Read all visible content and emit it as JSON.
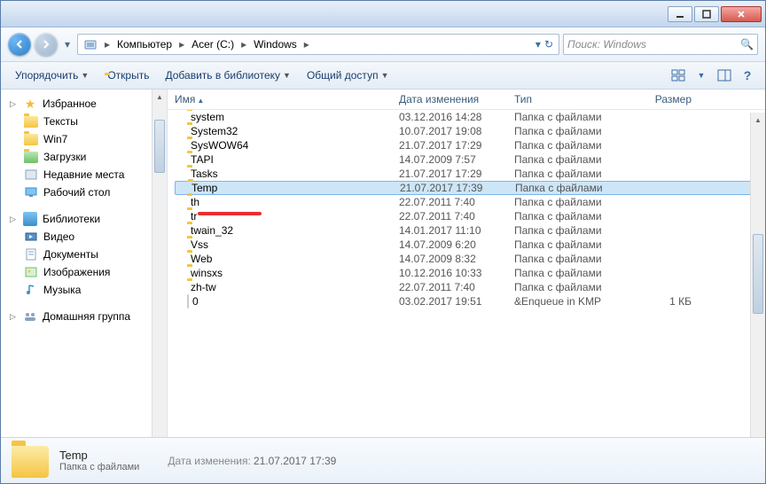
{
  "window": {
    "title": ""
  },
  "breadcrumb": {
    "items": [
      "Компьютер",
      "Acer (C:)",
      "Windows"
    ]
  },
  "search": {
    "placeholder": "Поиск: Windows"
  },
  "toolbar": {
    "organize": "Упорядочить",
    "open": "Открыть",
    "add_lib": "Добавить в библиотеку",
    "share": "Общий доступ"
  },
  "sidebar": {
    "favorites": {
      "label": "Избранное",
      "items": [
        "Тексты",
        "Win7",
        "Загрузки",
        "Недавние места",
        "Рабочий стол"
      ]
    },
    "libraries": {
      "label": "Библиотеки",
      "items": [
        "Видео",
        "Документы",
        "Изображения",
        "Музыка"
      ]
    },
    "homegroup": {
      "label": "Домашняя группа"
    }
  },
  "columns": {
    "name": "Имя",
    "date": "Дата изменения",
    "type": "Тип",
    "size": "Размер"
  },
  "files": [
    {
      "name": "system",
      "date": "03.12.2016 14:28",
      "type": "Папка с файлами",
      "size": "",
      "kind": "folder"
    },
    {
      "name": "System32",
      "date": "10.07.2017 19:08",
      "type": "Папка с файлами",
      "size": "",
      "kind": "folder"
    },
    {
      "name": "SysWOW64",
      "date": "21.07.2017 17:29",
      "type": "Папка с файлами",
      "size": "",
      "kind": "folder"
    },
    {
      "name": "TAPI",
      "date": "14.07.2009 7:57",
      "type": "Папка с файлами",
      "size": "",
      "kind": "folder"
    },
    {
      "name": "Tasks",
      "date": "21.07.2017 17:29",
      "type": "Папка с файлами",
      "size": "",
      "kind": "folder"
    },
    {
      "name": "Temp",
      "date": "21.07.2017 17:39",
      "type": "Папка с файлами",
      "size": "",
      "kind": "folder",
      "selected": true
    },
    {
      "name": "th",
      "date": "22.07.2011 7:40",
      "type": "Папка с файлами",
      "size": "",
      "kind": "folder"
    },
    {
      "name": "tr",
      "date": "22.07.2011 7:40",
      "type": "Папка с файлами",
      "size": "",
      "kind": "folder"
    },
    {
      "name": "twain_32",
      "date": "14.01.2017 11:10",
      "type": "Папка с файлами",
      "size": "",
      "kind": "folder"
    },
    {
      "name": "Vss",
      "date": "14.07.2009 6:20",
      "type": "Папка с файлами",
      "size": "",
      "kind": "folder"
    },
    {
      "name": "Web",
      "date": "14.07.2009 8:32",
      "type": "Папка с файлами",
      "size": "",
      "kind": "folder"
    },
    {
      "name": "winsxs",
      "date": "10.12.2016 10:33",
      "type": "Папка с файлами",
      "size": "",
      "kind": "folder"
    },
    {
      "name": "zh-tw",
      "date": "22.07.2011 7:40",
      "type": "Папка с файлами",
      "size": "",
      "kind": "folder"
    },
    {
      "name": "0",
      "date": "03.02.2017 19:51",
      "type": "&Enqueue in KMP",
      "size": "1 КБ",
      "kind": "file"
    }
  ],
  "status": {
    "title": "Temp",
    "subtitle": "Папка с файлами",
    "date_label": "Дата изменения:",
    "date_value": "21.07.2017 17:39"
  }
}
